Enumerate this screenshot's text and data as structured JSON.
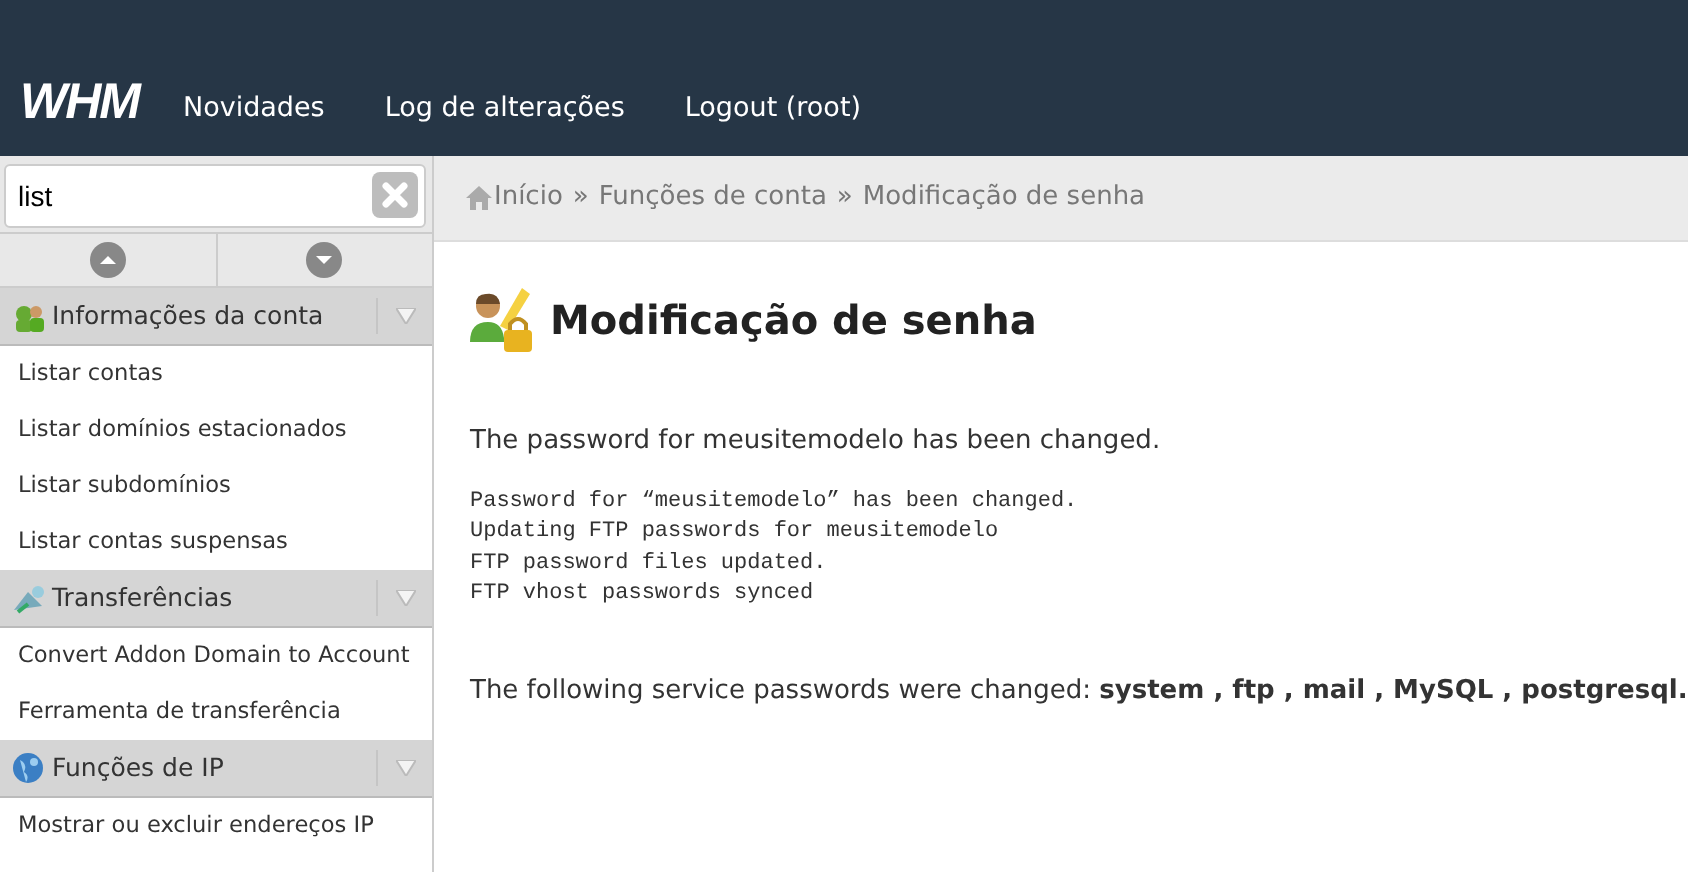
{
  "header": {
    "logo": "WHM",
    "links": [
      "Novidades",
      "Log de alterações",
      "Logout (root)"
    ]
  },
  "sidebar": {
    "search": {
      "value": "list"
    },
    "sections": [
      {
        "title": "Informações da conta",
        "expanded": true,
        "items": [
          "Listar contas",
          "Listar domínios estacionados",
          "Listar subdomínios",
          "Listar contas suspensas"
        ]
      },
      {
        "title": "Transferências",
        "expanded": true,
        "items": [
          "Convert Addon Domain to Account",
          "Ferramenta de transferência"
        ]
      },
      {
        "title": "Funções de IP",
        "expanded": true,
        "items": [
          "Mostrar ou excluir endereços IP"
        ]
      }
    ]
  },
  "breadcrumb": {
    "separator": "»",
    "items": [
      "Início",
      "Funções de conta",
      "Modificação de senha"
    ]
  },
  "page": {
    "title": "Modificação de senha",
    "message": "The password for meusitemodelo has been changed.",
    "log": [
      "Password for “meusitemodelo” has been changed.",
      "Updating FTP passwords for meusitemodelo",
      "FTP password files updated.",
      "FTP vhost passwords synced"
    ],
    "services": "The following service passwords were changed: **system , ftp , mail , MySQL , postgresql.**"
  }
}
